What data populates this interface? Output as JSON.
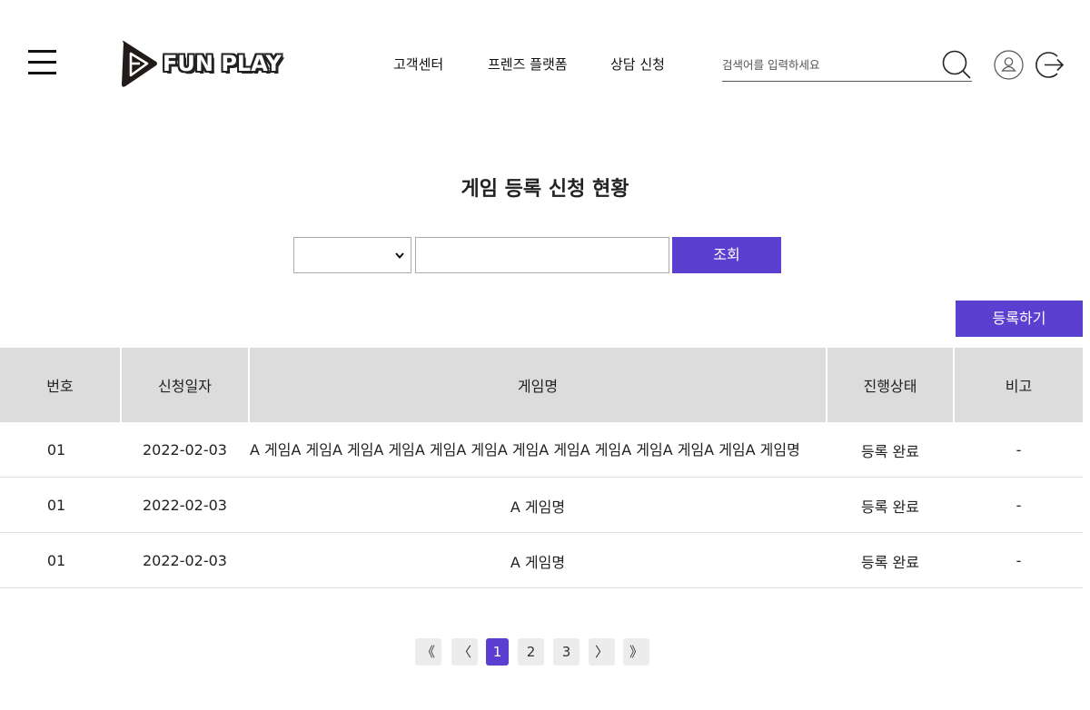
{
  "header": {
    "logo_text": "FUN PLAY",
    "nav": [
      {
        "label": "고객센터"
      },
      {
        "label": "프렌즈 플랫폼"
      },
      {
        "label": "상담 신청"
      }
    ],
    "search_placeholder": "검색어를 입력하세요"
  },
  "page": {
    "title": "게임 등록 신청 현황"
  },
  "filter": {
    "select_value": "",
    "input_value": "",
    "submit_label": "조회"
  },
  "register_label": "등록하기",
  "table": {
    "columns": [
      "번호",
      "신청일자",
      "게임명",
      "진행상태",
      "비고"
    ],
    "rows": [
      {
        "no": "01",
        "date": "2022-02-03",
        "name": "A 게임A 게임A 게임A 게임A 게임A 게임A 게임A 게임A 게임A 게임A 게임A 게임A 게임명",
        "status": "등록 완료",
        "note": "-"
      },
      {
        "no": "01",
        "date": "2022-02-03",
        "name": "A 게임명",
        "status": "등록 완료",
        "note": "-"
      },
      {
        "no": "01",
        "date": "2022-02-03",
        "name": "A 게임명",
        "status": "등록 완료",
        "note": "-"
      }
    ]
  },
  "pagination": {
    "first": "《",
    "prev": "〈",
    "pages": [
      "1",
      "2",
      "3"
    ],
    "current": "1",
    "next": "〉",
    "last": "》"
  },
  "colors": {
    "accent": "#5a3fd0",
    "header_bg": "#dcdcdc"
  }
}
